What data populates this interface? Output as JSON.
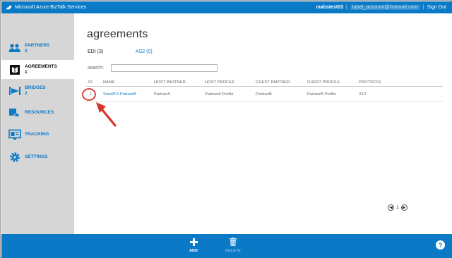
{
  "topbar": {
    "app_title": "Microsoft Azure BizTalk Services",
    "username": "mabstest03",
    "email": "label_account@hotmail.com",
    "separator": "|",
    "sign_out": "Sign Out"
  },
  "sidebar": {
    "items": [
      {
        "label": "PARTNERS",
        "count": "2",
        "icon": "partners-icon"
      },
      {
        "label": "AGREEMENTS",
        "count": "1",
        "icon": "agreements-icon"
      },
      {
        "label": "BRIDGES",
        "count": "2",
        "icon": "bridges-icon"
      },
      {
        "label": "RESOURCES",
        "count": "",
        "icon": "resources-icon"
      },
      {
        "label": "TRACKING",
        "count": "",
        "icon": "tracking-icon"
      },
      {
        "label": "SETTINGS",
        "count": "",
        "icon": "settings-icon"
      }
    ],
    "active_index": 1
  },
  "main": {
    "title": "agreements",
    "tabs": [
      {
        "label": "EDI (3)",
        "active": true
      },
      {
        "label": "AS2 (0)",
        "active": false
      }
    ],
    "search": {
      "label": "search:",
      "value": ""
    },
    "table": {
      "columns": [
        "ID",
        "NAME",
        "HOST PARTNER",
        "HOST PROFILE",
        "GUEST PARTNER",
        "GUEST PROFILE",
        "PROTOCOL"
      ],
      "rows": [
        [
          "1",
          "SendPO-PartnerB",
          "PartnerA",
          "PartnerA Profile",
          "PartnerB",
          "PartnerB Profile",
          "X12"
        ]
      ]
    },
    "pager": {
      "prev": "◀",
      "page": "1",
      "next": "▶"
    }
  },
  "commandbar": {
    "add_label": "ADD",
    "delete_label": "DELETE",
    "help_label": "?"
  },
  "colors": {
    "accent": "#0a7ac7",
    "sidebar_bg": "#d6d6d6",
    "annotation": "#d9342b"
  }
}
